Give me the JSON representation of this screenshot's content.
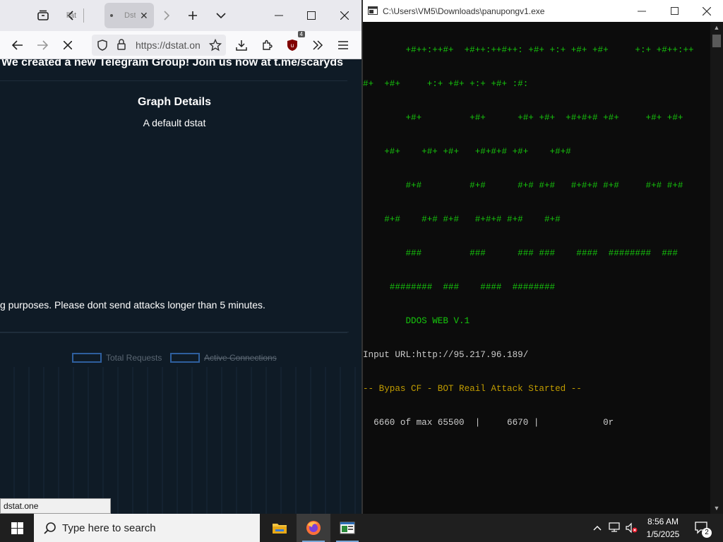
{
  "browser": {
    "tabs": [
      {
        "label": "llat",
        "active": false
      },
      {
        "label": "Dst",
        "active": true
      }
    ],
    "url": "https://dstat.on",
    "extension_badge": "4",
    "status_url": "dstat.one",
    "page": {
      "banner": "We created a new Telegram Group! Join us now at t.me/scaryds",
      "graph_title": "Graph Details",
      "graph_subtitle": "A default dstat",
      "purpose_text": "g purposes. Please dont send attacks longer than 5 minutes.",
      "legend": [
        "Total Requests",
        "Active Connections"
      ]
    }
  },
  "console": {
    "title": "C:\\Users\\VM5\\Downloads\\panupongv1.exe",
    "lines": [
      {
        "text": "        +#++:++#+  +#++:++#++: +#+ +:+ +#+ +#+     +:+ +#++:++",
        "color": "#16c60c"
      },
      {
        "text": "#+  +#+     +:+ +#+ +:+ +#+ :#:",
        "color": "#16c60c"
      },
      {
        "text": "        +#+         +#+      +#+ +#+  +#+#+# +#+     +#+ +#+",
        "color": "#16c60c"
      },
      {
        "text": "    +#+    +#+ +#+   +#+#+# +#+    +#+#",
        "color": "#16c60c"
      },
      {
        "text": "        #+#         #+#      #+# #+#   #+#+# #+#     #+# #+#",
        "color": "#16c60c"
      },
      {
        "text": "    #+#    #+# #+#   #+#+# #+#    #+#",
        "color": "#16c60c"
      },
      {
        "text": "        ###         ###      ### ###    ####  ########  ###",
        "color": "#16c60c"
      },
      {
        "text": "     ########  ###    ####  ########",
        "color": "#16c60c"
      },
      {
        "text": "        DDOS WEB V.1",
        "color": "#16c60c"
      },
      {
        "text": "Input URL:http://95.217.96.189/",
        "color": "#cccccc"
      },
      {
        "text": "-- Bypas CF - BOT Reail Attack Started --",
        "color": "#c19c00"
      },
      {
        "text": "  6660 of max 65500  |     6670 |            0r",
        "color": "#cccccc"
      }
    ]
  },
  "taskbar": {
    "search_placeholder": "Type here to search",
    "time": "8:56 AM",
    "date": "1/5/2025",
    "notification_count": "2"
  },
  "colors": {
    "page_bg": "#0f1b26",
    "console_bg": "#0c0c0c",
    "console_green": "#16c60c",
    "console_yellow": "#c19c00",
    "legend_blue": "#2e5f9e"
  }
}
